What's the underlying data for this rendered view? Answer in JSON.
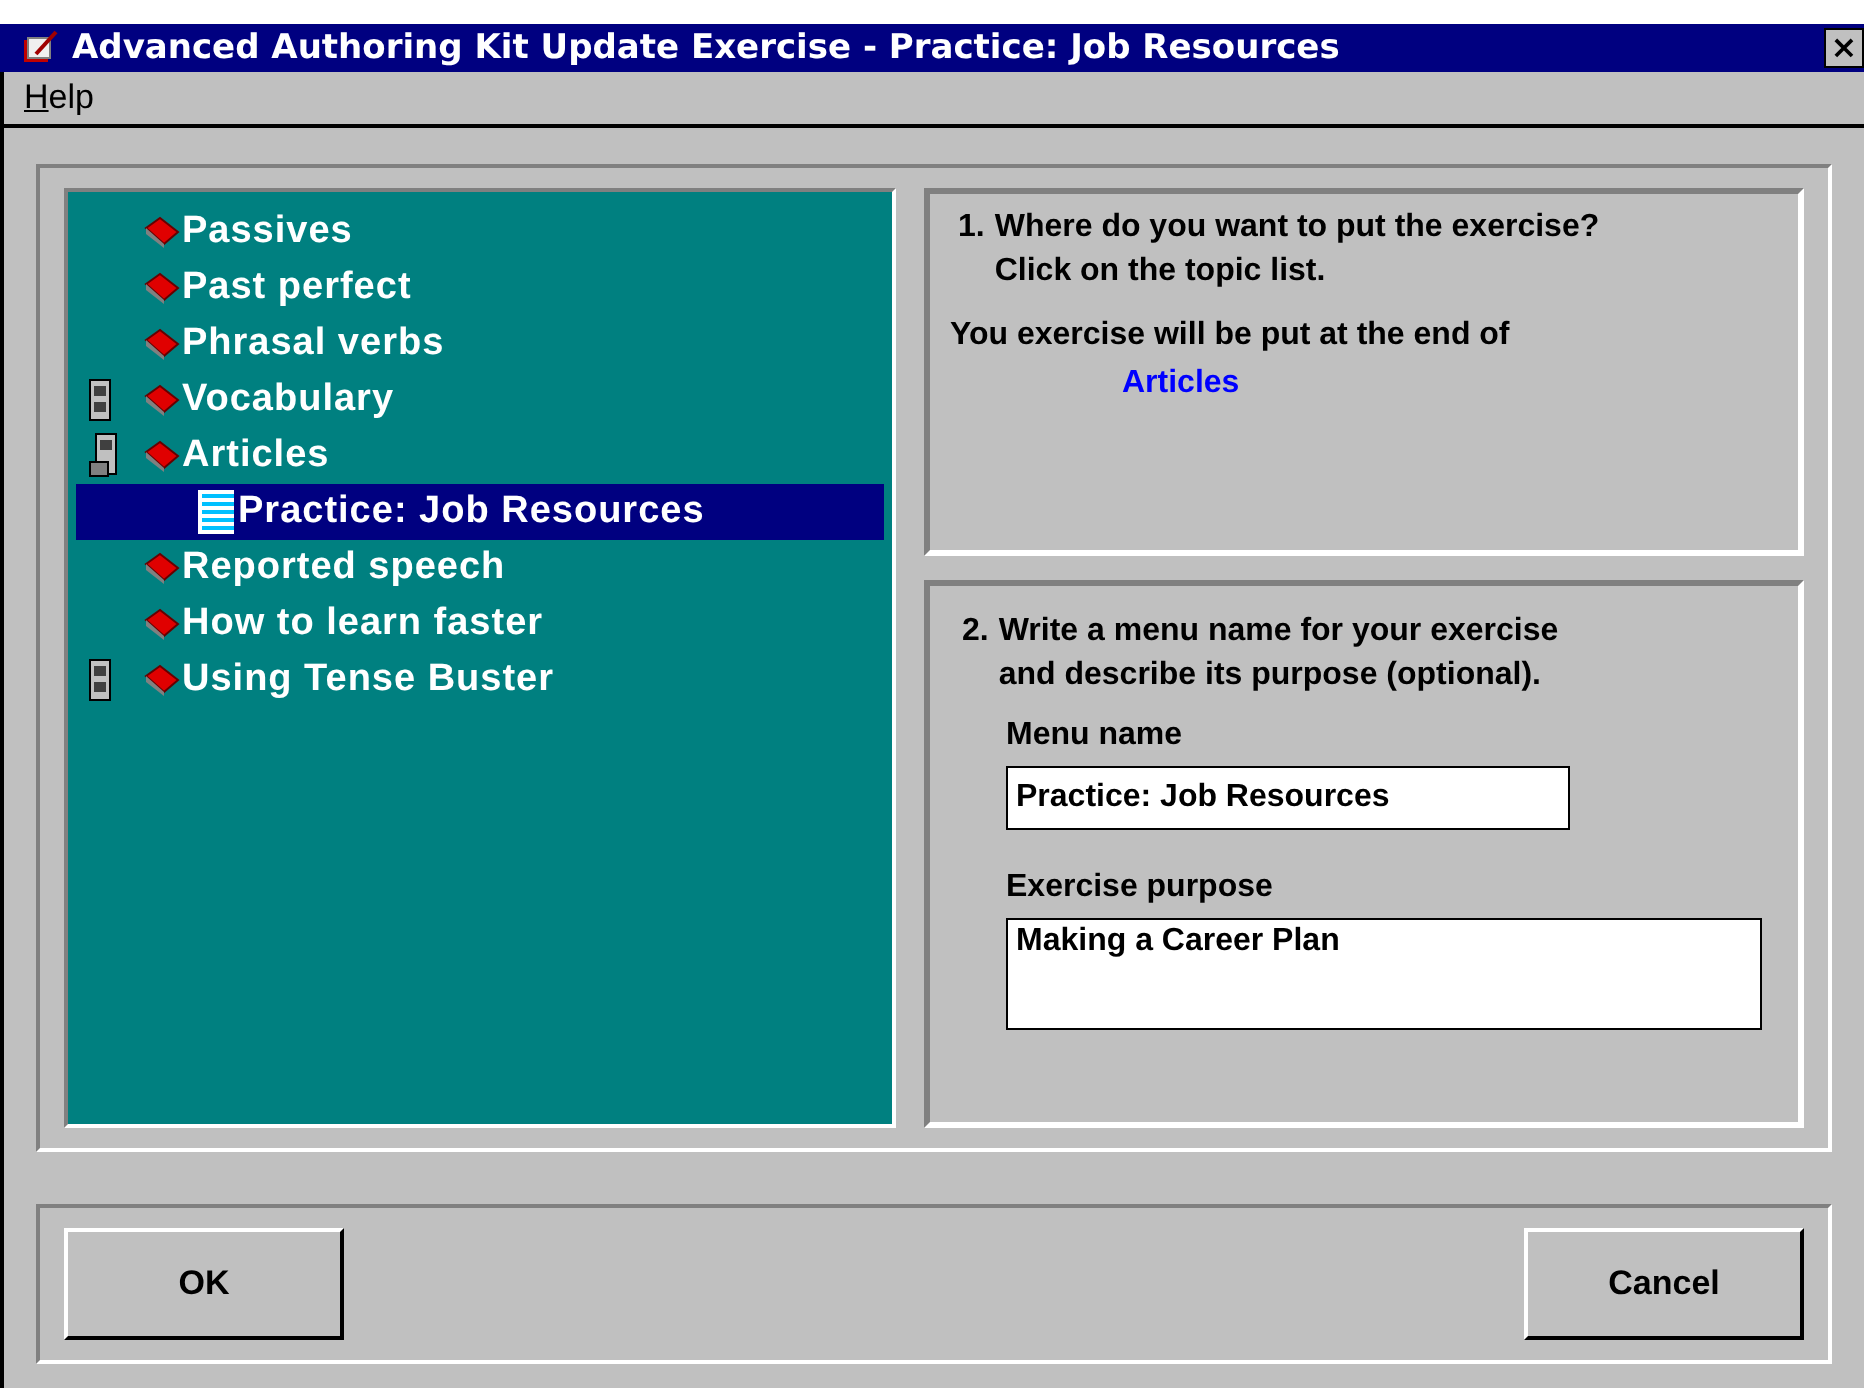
{
  "window": {
    "title": "Advanced Authoring Kit Update Exercise - Practice: Job Resources",
    "close": "×"
  },
  "menu": [
    "Help"
  ],
  "topics": [
    {
      "label": "Passives",
      "kind": "book",
      "selected": false
    },
    {
      "label": "Past perfect",
      "kind": "book",
      "selected": false
    },
    {
      "label": "Phrasal verbs",
      "kind": "book",
      "selected": false
    },
    {
      "label": "Vocabulary",
      "kind": "book",
      "selected": false,
      "expanded": false
    },
    {
      "label": "Articles",
      "kind": "book",
      "selected": false,
      "expanded": true,
      "children": [
        {
          "label": "Practice: Job Resources",
          "kind": "page",
          "selected": true
        }
      ]
    },
    {
      "label": "Reported speech",
      "kind": "book",
      "selected": false
    },
    {
      "label": "How to learn faster",
      "kind": "book",
      "selected": false
    },
    {
      "label": "Using Tense Buster",
      "kind": "book",
      "selected": false,
      "expanded": false
    }
  ],
  "step1": {
    "number": "1.",
    "question": "Where do you want to put the exercise?",
    "hint": "Click on the topic list.",
    "info": "You exercise will be put at the end of",
    "target": "Articles"
  },
  "step2": {
    "number": "2.",
    "line1": "Write a menu name for your exercise",
    "line2": "and describe its purpose (optional).",
    "menu_name": {
      "label": "Menu name",
      "value": "Practice: Job Resources"
    },
    "purpose": {
      "label": "Exercise purpose",
      "value": "Making a Career Plan"
    }
  },
  "buttons": [
    "OK",
    "Cancel"
  ]
}
